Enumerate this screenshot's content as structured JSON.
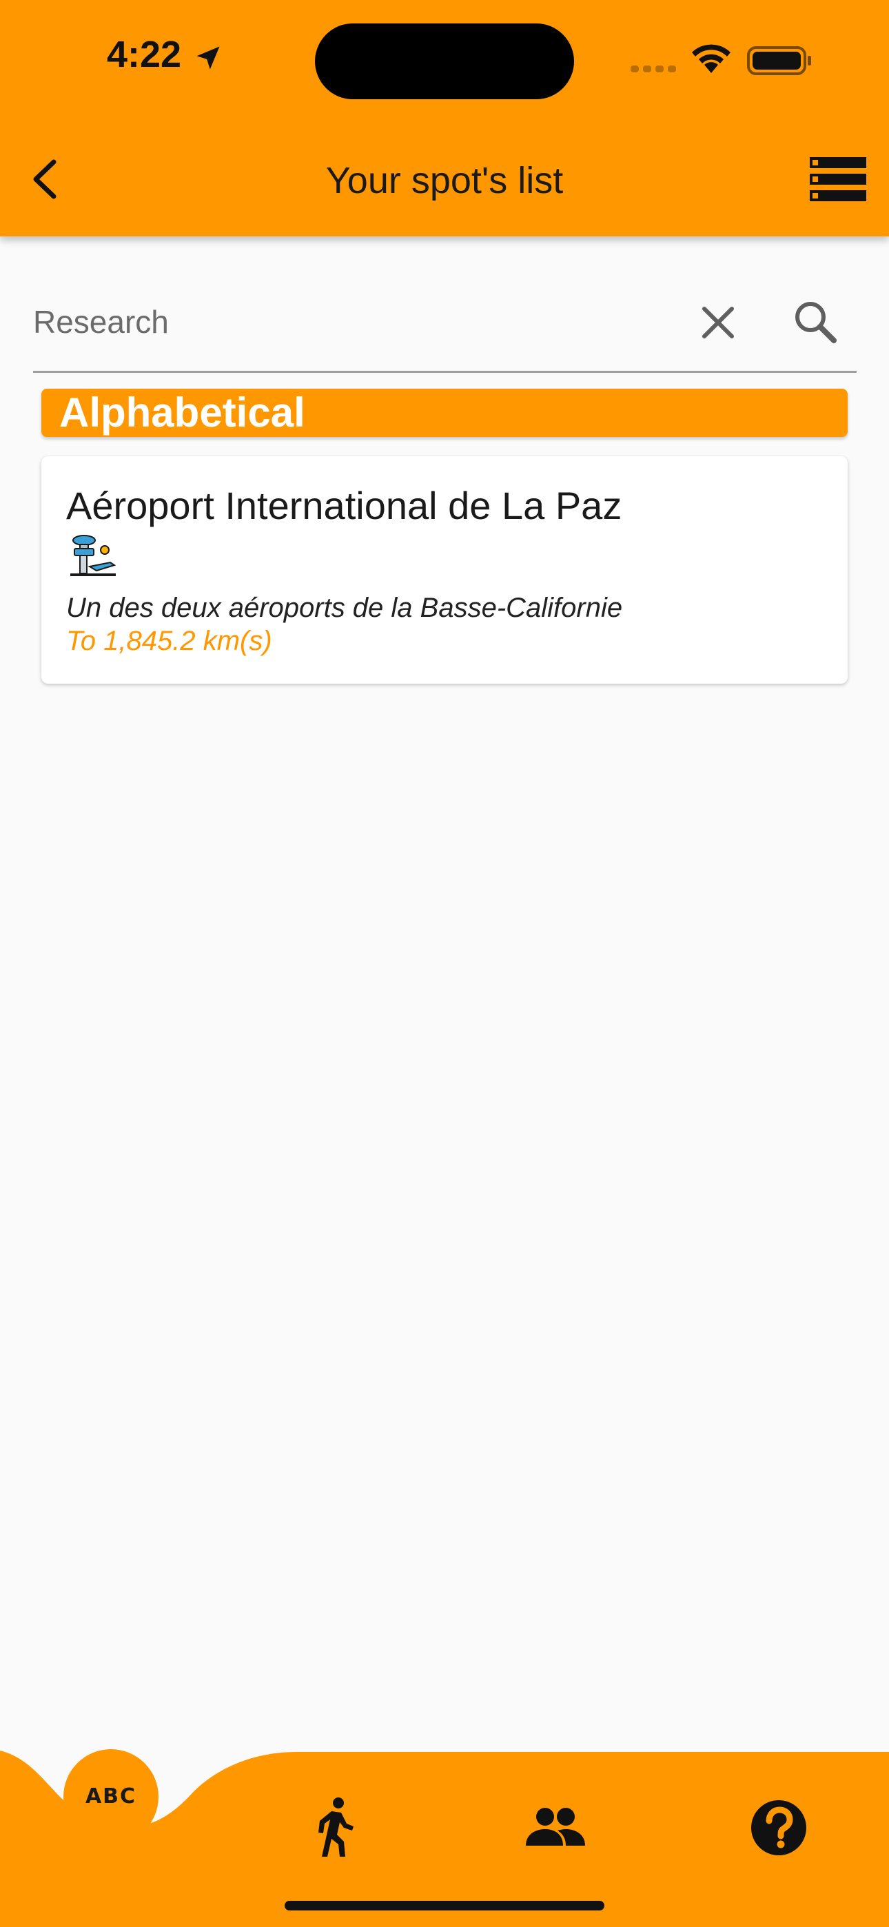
{
  "status_bar": {
    "time": "4:22"
  },
  "header": {
    "title": "Your spot's list"
  },
  "search": {
    "placeholder": "Research",
    "value": ""
  },
  "section": {
    "label": "Alphabetical"
  },
  "spots": [
    {
      "name": "Aéroport International de La Paz",
      "icon": "airport-icon",
      "description": "Un des deux aéroports de la Basse-Californie",
      "distance": "To 1,845.2 km(s)"
    }
  ],
  "bottom_nav": {
    "items": [
      {
        "label": "ABC",
        "icon": "alphabetical-sort-icon",
        "active": true
      },
      {
        "icon": "walking-person-icon"
      },
      {
        "icon": "people-group-icon"
      },
      {
        "icon": "help-icon"
      }
    ]
  },
  "colors": {
    "accent": "#FF9800",
    "background": "#FAFAFA",
    "card": "#FFFFFF",
    "text": "#1A1A1A"
  }
}
